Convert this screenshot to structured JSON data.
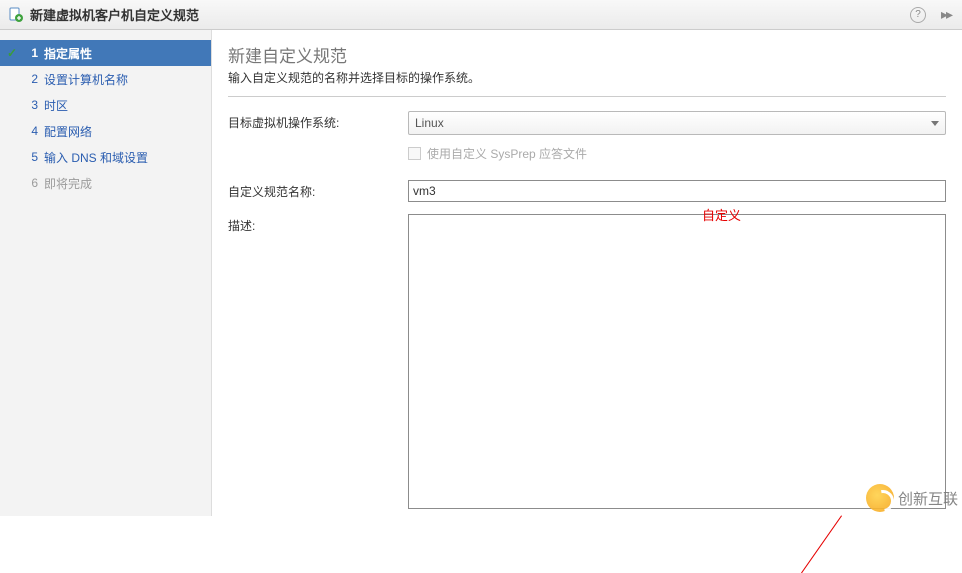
{
  "header": {
    "title": "新建虚拟机客户机自定义规范",
    "help_label": "?"
  },
  "sidebar": {
    "steps": [
      {
        "num": "1",
        "label": "指定属性"
      },
      {
        "num": "2",
        "label": "设置计算机名称"
      },
      {
        "num": "3",
        "label": "时区"
      },
      {
        "num": "4",
        "label": "配置网络"
      },
      {
        "num": "5",
        "label": "输入 DNS 和域设置"
      },
      {
        "num": "6",
        "label": "即将完成"
      }
    ]
  },
  "main": {
    "title": "新建自定义规范",
    "subtitle": "输入自定义规范的名称并选择目标的操作系统。",
    "fields": {
      "os_label": "目标虚拟机操作系统:",
      "os_value": "Linux",
      "sysprep_label": "使用自定义 SysPrep 应答文件",
      "name_label": "自定义规范名称:",
      "name_value": "vm3",
      "desc_label": "描述:",
      "desc_value": ""
    }
  },
  "annotations": {
    "custom_note": "自定义"
  },
  "watermark": {
    "text": "创新互联"
  }
}
